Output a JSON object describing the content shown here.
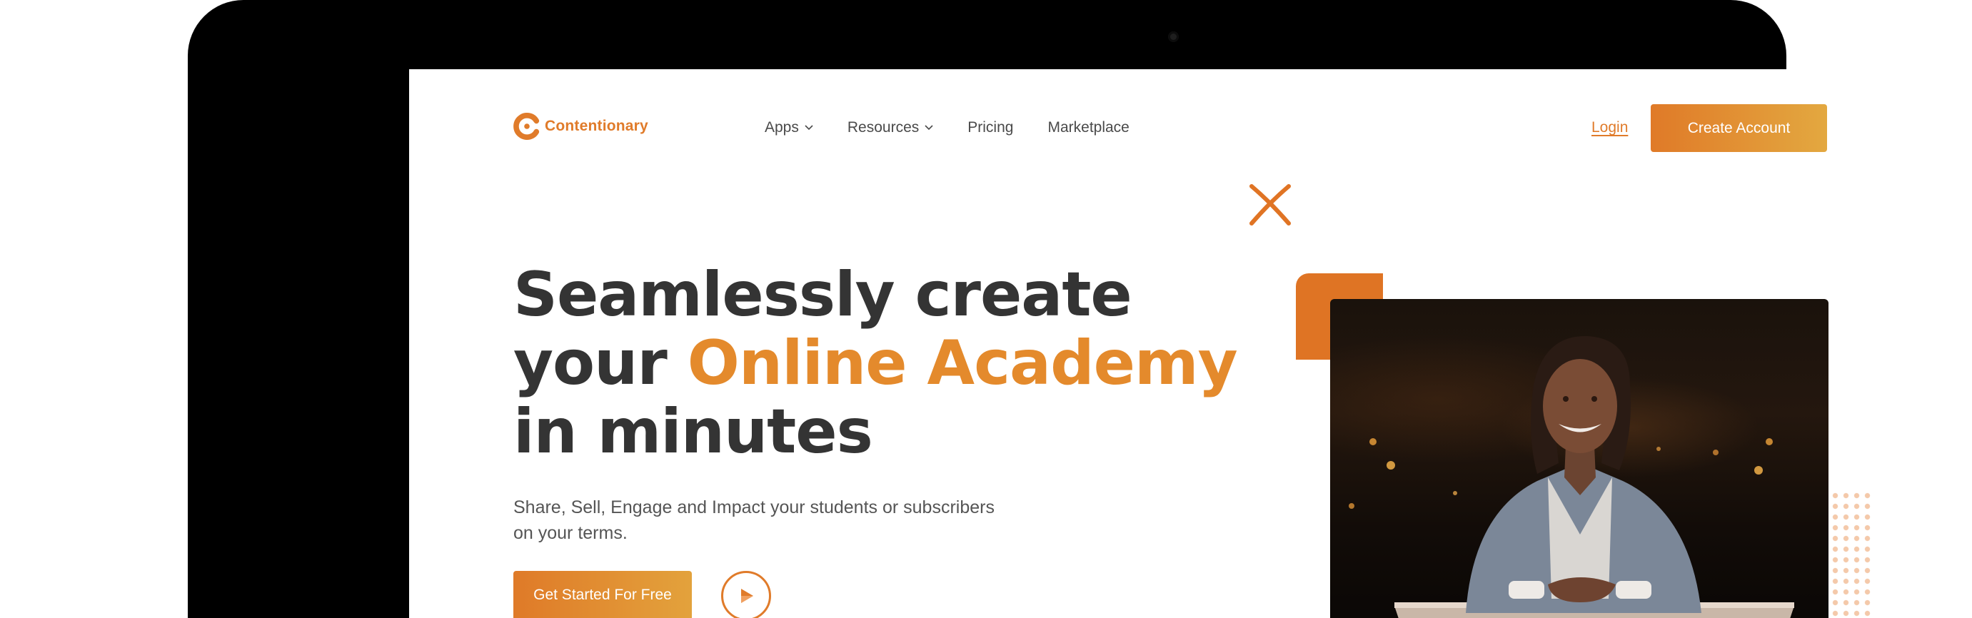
{
  "brand": {
    "name": "Contentionary",
    "color": "#e07b2a"
  },
  "nav": {
    "items": [
      {
        "label": "Apps",
        "has_dropdown": true
      },
      {
        "label": "Resources",
        "has_dropdown": true
      },
      {
        "label": "Pricing",
        "has_dropdown": false
      },
      {
        "label": "Marketplace",
        "has_dropdown": false
      }
    ],
    "login_label": "Login",
    "create_account_label": "Create Account"
  },
  "hero": {
    "headline_line1": "Seamlessly create",
    "headline_line2_prefix": "your ",
    "headline_accent": "Online Academy",
    "headline_line3": "in minutes",
    "subtext": "Share, Sell, Engage and Impact your students or subscribers on your terms.",
    "cta_label": "Get Started For Free"
  },
  "icons": {
    "logo": "contentionary-logo-icon",
    "dropdown": "chevron-down-icon",
    "play": "play-icon",
    "decor": "x-decor-icon"
  },
  "colors": {
    "accent": "#e07b2a",
    "accent_gradient_end": "#e3a840",
    "headline": "#343434",
    "body_text": "#555555"
  }
}
